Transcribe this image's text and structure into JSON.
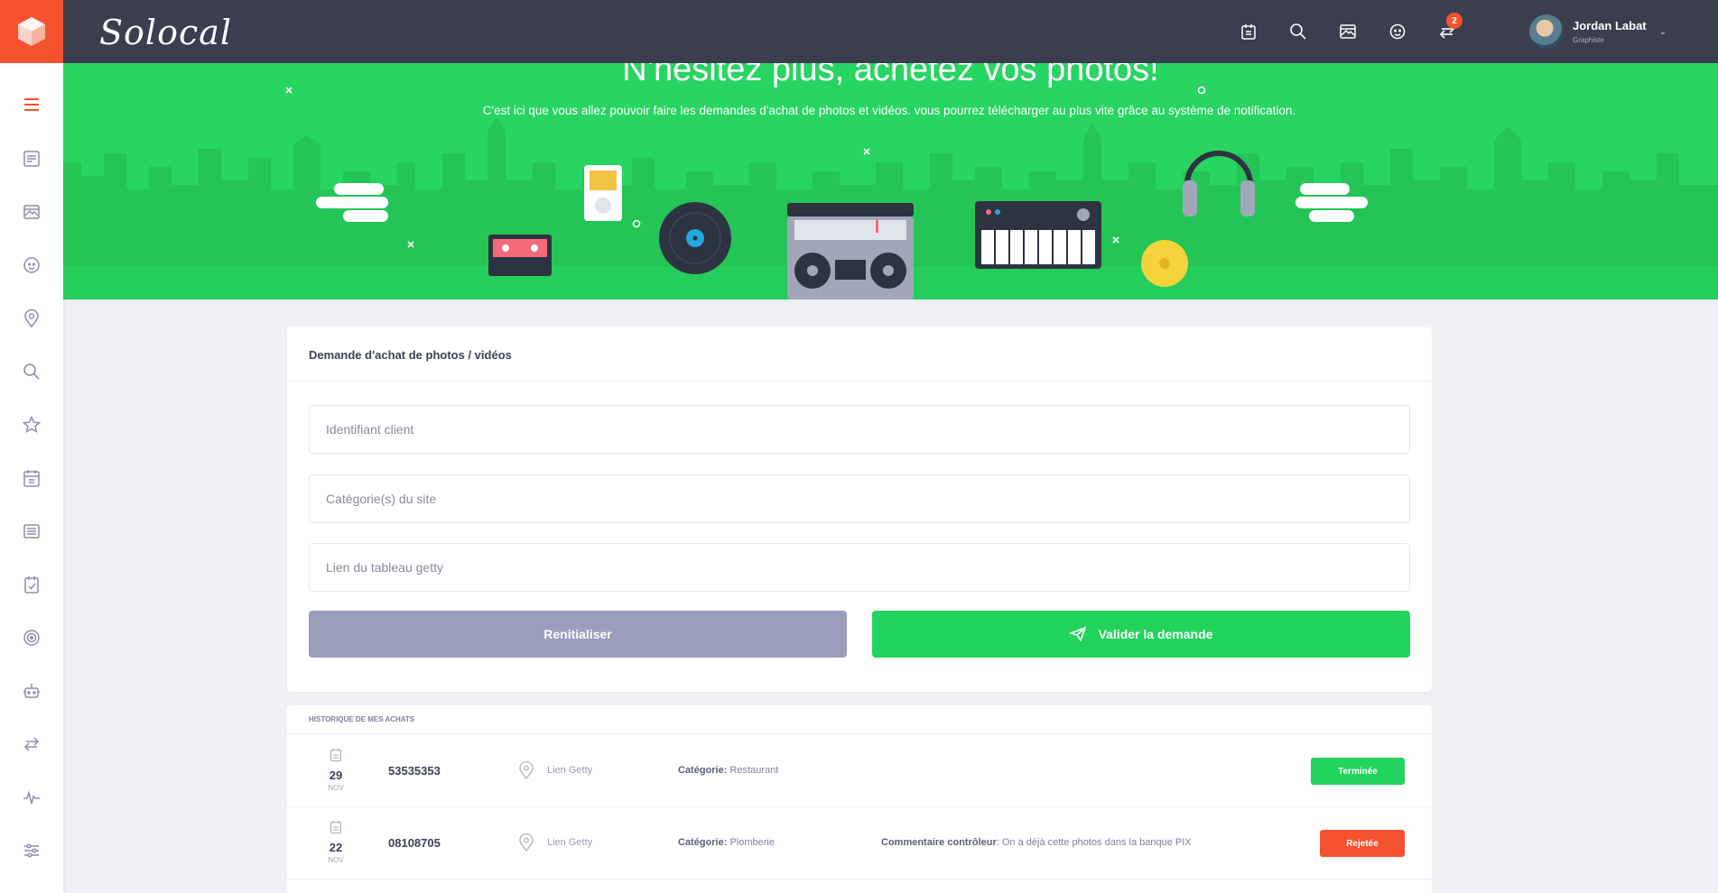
{
  "app": {
    "brand": "Solocal"
  },
  "header": {
    "notification_count": "2",
    "icons": [
      "calendar-icon",
      "search-icon",
      "gallery-icon",
      "face-icon",
      "transfer-icon"
    ],
    "user": {
      "name": "Jordan Labat",
      "role": "Graphiste"
    }
  },
  "sidebar": {
    "items": [
      "menu-icon",
      "articles-icon",
      "gallery-icon",
      "face-icon",
      "location-icon",
      "search-icon",
      "star-icon",
      "calendar-icon",
      "news-icon",
      "checklist-icon",
      "target-icon",
      "robot-icon",
      "transfer-icon",
      "activity-icon",
      "settings-icon"
    ]
  },
  "banner": {
    "title": "N'hésitez plus, achetez vos photos!",
    "text": "C'est ici que vous allez pouvoir faire les demandes d'achat de photos et vidéos. vous pourrez télécharger au plus vite grâce au système de notification."
  },
  "form": {
    "title": "Demande d'achat de photos / vidéos",
    "client_id_placeholder": "Identifiant client",
    "category_placeholder": "Catégorie(s) du site",
    "getty_link_placeholder": "Lien du tableau getty",
    "reset_label": "Renitialiser",
    "submit_label": "Valider la demande"
  },
  "history": {
    "title": "Historique de mes achats",
    "category_label": "Catégorie:",
    "comment_label": "Commentaire contrôleur",
    "rows": [
      {
        "day": "29",
        "month": "NOV",
        "id": "53535353",
        "link": "Lien Getty",
        "category": "Restaurant",
        "comment": "",
        "status": "Terminée"
      },
      {
        "day": "22",
        "month": "NOV",
        "id": "08108705",
        "link": "Lien Getty",
        "category": "Plomberie",
        "comment": ": On a déjà cette photos dans la banque PIX",
        "status": "Rejetée"
      }
    ]
  },
  "colors": {
    "brand": "#f4522f",
    "topbar": "#3b3e4f",
    "banner": "#28d462",
    "success": "#22d35d",
    "danger": "#f4522f",
    "muted_button": "#9b9dbd"
  }
}
